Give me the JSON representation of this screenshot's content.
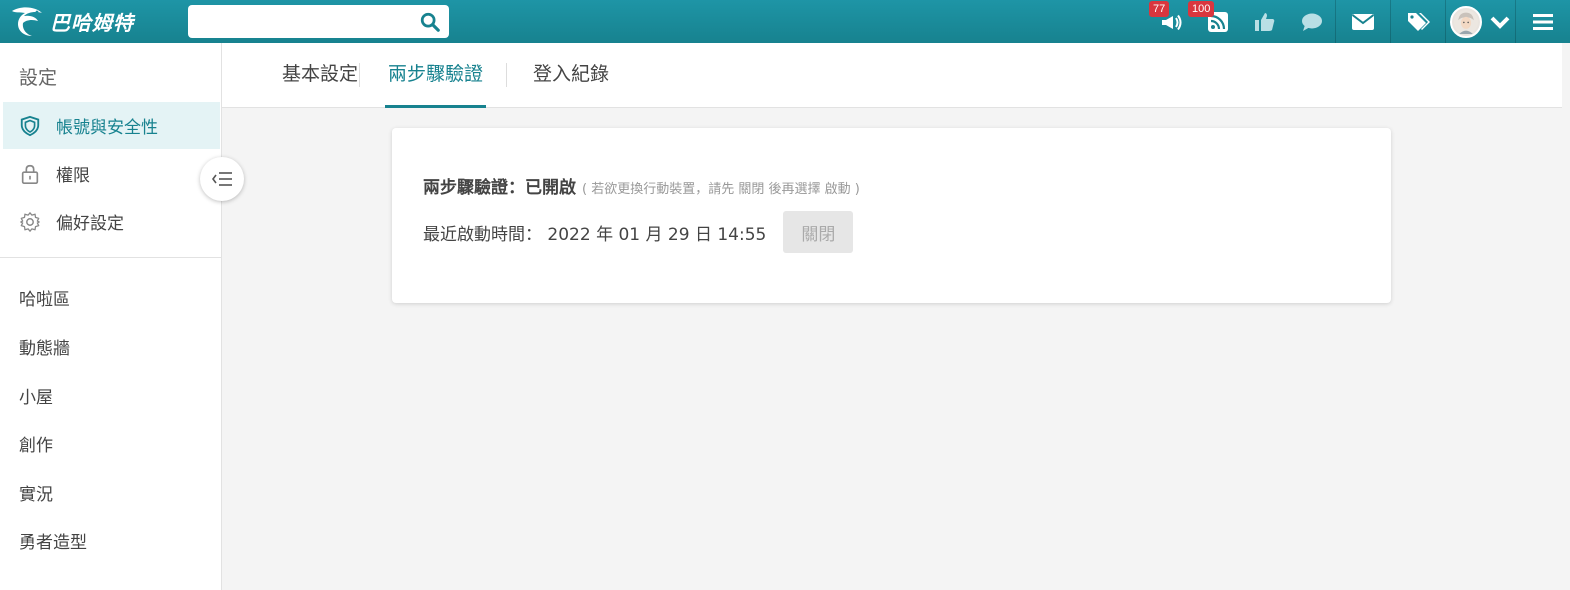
{
  "header": {
    "logo_text": "巴哈姆特",
    "search": {
      "value": "",
      "placeholder": ""
    },
    "badges": {
      "notifications": "77",
      "subscriptions": "100"
    },
    "icons": [
      "megaphone-icon",
      "rss-icon",
      "thumbs-up-icon",
      "chat-icon",
      "mail-icon",
      "tags-icon",
      "avatar",
      "chevron-down-icon",
      "menu-icon"
    ],
    "accent_color": "#1c8fa0"
  },
  "sidebar": {
    "title": "設定",
    "settings_items": [
      {
        "label": "帳號與安全性",
        "icon": "shield-icon",
        "active": true
      },
      {
        "label": "權限",
        "icon": "lock-icon",
        "active": false
      },
      {
        "label": "偏好設定",
        "icon": "gear-icon",
        "active": false
      }
    ],
    "links": [
      "哈啦區",
      "動態牆",
      "小屋",
      "創作",
      "實況",
      "勇者造型"
    ]
  },
  "tabs": [
    {
      "label": "基本設定",
      "active": false
    },
    {
      "label": "兩步驟驗證",
      "active": true
    },
    {
      "label": "登入紀錄",
      "active": false
    }
  ],
  "card": {
    "status_label": "兩步驟驗證：已開啟",
    "status_hint": "( 若欲更換行動裝置，請先 關閉 後再選擇 啟動 )",
    "recent_label": "最近啟動時間： 2022 年 01 月 29 日 14:55",
    "close_button": "關閉"
  }
}
